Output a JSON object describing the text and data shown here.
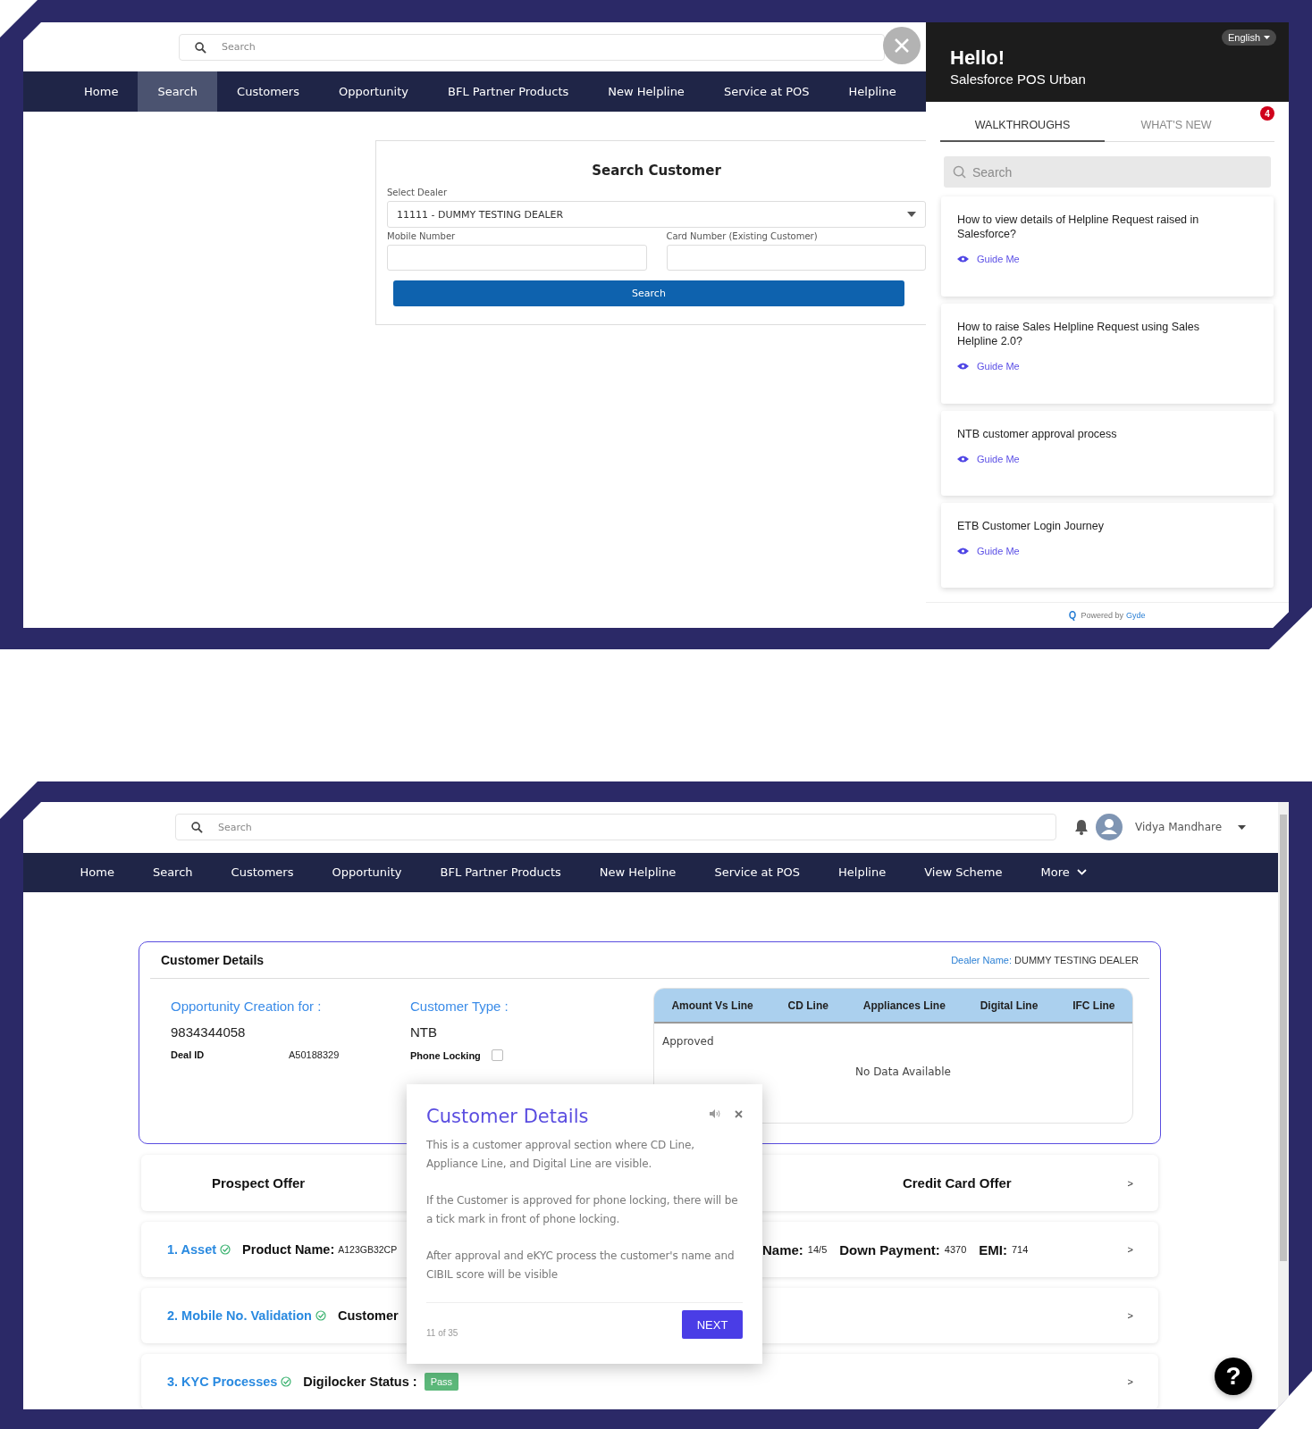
{
  "top_screen": {
    "search": {
      "placeholder": "Search"
    },
    "nav": [
      {
        "label": "Home",
        "selected": false
      },
      {
        "label": "Search",
        "selected": true
      },
      {
        "label": "Customers",
        "selected": false
      },
      {
        "label": "Opportunity",
        "selected": false
      },
      {
        "label": "BFL Partner Products",
        "selected": false
      },
      {
        "label": "New Helpline",
        "selected": false
      },
      {
        "label": "Service at POS",
        "selected": false
      },
      {
        "label": "Helpline",
        "selected": false
      }
    ],
    "search_customer": {
      "title": "Search Customer",
      "dealer_label": "Select Dealer",
      "dealer_value": "11111 - DUMMY TESTING DEALER",
      "mobile_label": "Mobile Number",
      "card_label": "Card Number (Existing Customer)",
      "button": "Search"
    },
    "panel": {
      "language": "English",
      "greeting": "Hello!",
      "subtitle": "Salesforce POS Urban",
      "tabs": [
        {
          "label": "WALKTHROUGHS",
          "selected": true
        },
        {
          "label": "WHAT'S NEW",
          "selected": false
        }
      ],
      "badge": "4",
      "search": {
        "placeholder": "Search"
      },
      "items": [
        {
          "title": "How to view details of Helpline Request raised in Salesforce?",
          "action": "Guide Me"
        },
        {
          "title": "How to raise Sales Helpline Request using Sales Helpline 2.0?",
          "action": "Guide Me"
        },
        {
          "title": "NTB customer approval process",
          "action": "Guide Me"
        },
        {
          "title": "ETB Customer Login Journey",
          "action": "Guide Me"
        }
      ],
      "footer": {
        "text": "Powered by",
        "brand": "Gyde"
      }
    }
  },
  "bottom_screen": {
    "search": {
      "placeholder": "Search"
    },
    "user": "Vidya Mandhare",
    "nav": [
      {
        "label": "Home",
        "kind": "link"
      },
      {
        "label": "Search",
        "kind": "link"
      },
      {
        "label": "Customers",
        "kind": "link"
      },
      {
        "label": "Opportunity",
        "kind": "link"
      },
      {
        "label": "BFL Partner Products",
        "kind": "link"
      },
      {
        "label": "New Helpline",
        "kind": "link"
      },
      {
        "label": "Service at POS",
        "kind": "link"
      },
      {
        "label": "Helpline",
        "kind": "link"
      },
      {
        "label": "View Scheme",
        "kind": "link"
      },
      {
        "label": "More",
        "kind": "menu"
      }
    ],
    "customer_details": {
      "title": "Customer Details",
      "dealer_label": "Dealer Name:",
      "dealer_value": "DUMMY TESTING DEALER",
      "opportunity_label": "Opportunity Creation for :",
      "phone": "9834344058",
      "deal_id_label": "Deal ID",
      "deal_id": "A50188329",
      "customer_type_label": "Customer Type :",
      "customer_type": "NTB",
      "phone_locking_label": "Phone Locking",
      "phone_locking_checked": false,
      "table": {
        "columns": [
          "Amount Vs Line",
          "CD Line",
          "Appliances Line",
          "Digital Line",
          "IFC Line"
        ],
        "row_label": "Approved",
        "empty": "No Data Available"
      }
    },
    "offers": {
      "left": "Prospect Offer",
      "right": "Credit Card Offer",
      "chevron": ">"
    },
    "steps": [
      {
        "title": "1. Asset",
        "done": true,
        "left_fields": [
          {
            "label": "Product Name:",
            "value": "A123GB32CP"
          }
        ],
        "right_fields": [
          {
            "label": "Name:",
            "value": "14/5"
          },
          {
            "label": "Down Payment:",
            "value": "4370"
          },
          {
            "label": "EMI:",
            "value": "714"
          }
        ],
        "chevron": ">"
      },
      {
        "title": "2. Mobile No. Validation",
        "done": true,
        "left_fields": [
          {
            "label": "Customer"
          }
        ],
        "chevron": ">"
      },
      {
        "title": "3. KYC Processes",
        "done": true,
        "left_fields": [
          {
            "label": "Digilocker Status :",
            "badge": "Pass"
          }
        ],
        "chevron": ">"
      }
    ],
    "tooltip": {
      "title": "Customer Details",
      "paragraphs": [
        "This is a customer approval section where CD Line, Appliance Line, and Digital Line are visible.",
        "If the Customer is approved for phone locking, there will be a tick mark in front of phone locking.",
        "After approval and eKYC process the customer's name and CIBIL score will be visible"
      ],
      "progress": "11 of 35",
      "button": "NEXT"
    },
    "help": "?"
  }
}
